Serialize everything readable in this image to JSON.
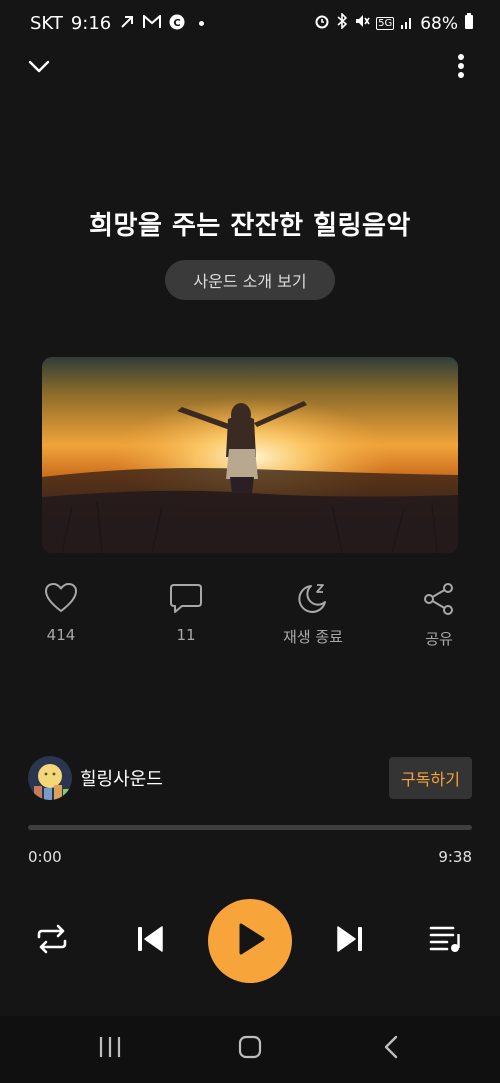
{
  "status_bar": {
    "carrier": "SKT",
    "time": "9:16",
    "network": "5G",
    "battery": "68%"
  },
  "header": {
    "collapse_icon": "chevron-down-icon",
    "more_icon": "more-vertical-icon"
  },
  "track": {
    "title": "희망을 주는 잔잔한 힐링음악",
    "intro_button": "사운드 소개 보기"
  },
  "actions": [
    {
      "icon": "heart-icon",
      "label": "414"
    },
    {
      "icon": "comment-icon",
      "label": "11"
    },
    {
      "icon": "sleep-timer-icon",
      "label": "재생 종료"
    },
    {
      "icon": "share-icon",
      "label": "공유"
    }
  ],
  "channel": {
    "name": "힐링사운드",
    "subscribe_label": "구독하기"
  },
  "player": {
    "current_time": "0:00",
    "duration": "9:38",
    "progress": 0
  },
  "colors": {
    "accent": "#f5a33b",
    "background": "#151515"
  }
}
